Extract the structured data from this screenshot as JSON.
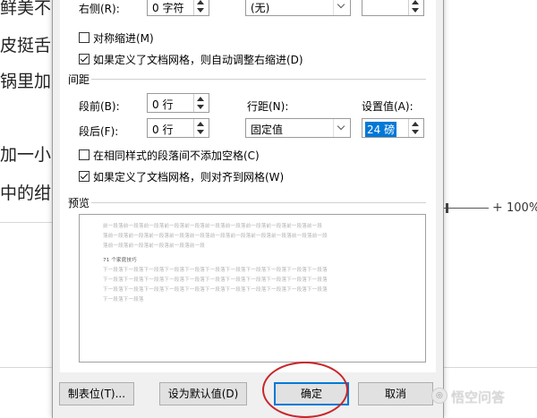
{
  "background_doc": {
    "lines": [
      "鲜美不",
      "皮挺舌",
      "锅里加",
      "加一小",
      "中的绀"
    ],
    "zoom_value": "100%",
    "zoom_plus": "+"
  },
  "dialog": {
    "right_indent": {
      "label": "右侧(R):",
      "value": "0 字符",
      "special_value": "(无)"
    },
    "checkbox_mirror": {
      "label": "对称缩进(M)",
      "checked": false
    },
    "checkbox_auto_right": {
      "label": "如果定义了文档网格，则自动调整右缩进(D)",
      "checked": true
    },
    "spacing": {
      "section_title": "间距",
      "before_label": "段前(B):",
      "before_value": "0 行",
      "after_label": "段后(F):",
      "after_value": "0 行",
      "line_spacing_label": "行距(N):",
      "line_spacing_value": "固定值",
      "set_value_label": "设置值(A):",
      "set_value": "24 磅"
    },
    "checkbox_no_space": {
      "label": "在相同样式的段落间不添加空格(C)",
      "checked": false
    },
    "checkbox_snap_grid": {
      "label": "如果定义了文档网格，则对齐到网格(W)",
      "checked": true
    },
    "preview": {
      "section_title": "预览",
      "prev_lines": [
        "前一段落前一段落前一段落前一段落前一段落前一段落前一段落前一段落前一段落前一段落前一段",
        "落前一段落前一段落前一段落前一段落前一段落前一段落前一段落前一段落前一段落前一段落前一段",
        "落前一段落前一段落前一段落前一段落前一段"
      ],
      "main_text": "71 个家庭技巧",
      "next_lines": [
        "下一段落下一段落下一段落下一段落下一段落下一段落下一段落下一段落下一段落下一段落下一段落",
        "下一段落下一段落下一段落下一段落下一段落下一段落下一段落下一段落下一段落下一段落下一段落",
        "下一段落下一段落下一段落下一段落下一段落下一段落下一段落下一段落下一段落下一段落下一段落",
        "下一段落下一段落"
      ]
    },
    "buttons": {
      "tabs": "制表位(T)...",
      "set_default": "设为默认值(D)",
      "ok": "确定",
      "cancel": "取消"
    }
  },
  "watermark": {
    "text": "悟空问答"
  },
  "colors": {
    "highlight": "#0078d7",
    "annotation_oval": "#c8262a"
  }
}
